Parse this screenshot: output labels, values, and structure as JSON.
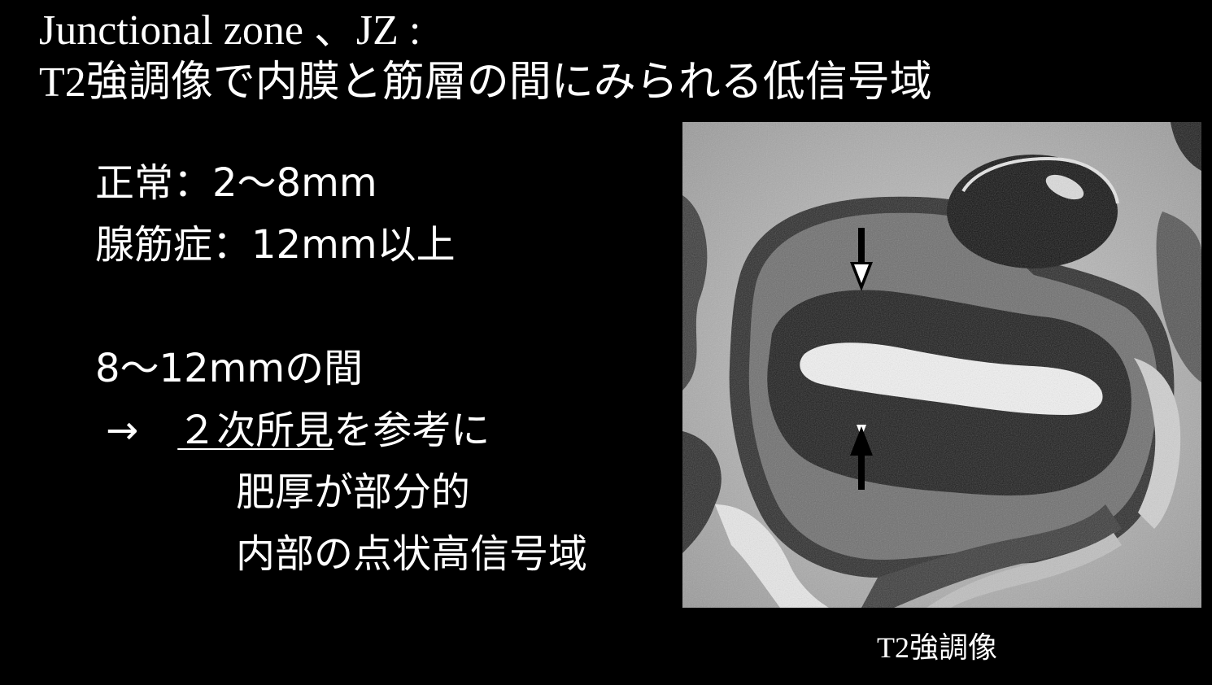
{
  "title": {
    "line1": "Junctional zone 、JZ :",
    "line2": "T2強調像で内膜と筋層の間にみられる低信号域"
  },
  "body": {
    "normal": "正常：2～8mm",
    "adenomyosis": "腺筋症：12mm以上",
    "between": "8～12mmの間",
    "arrow": "→",
    "secondary_underlined": "２次所見",
    "secondary_rest": "を参考に",
    "finding1": "肥厚が部分的",
    "finding2": "内部の点状高信号域"
  },
  "image": {
    "caption": "T2強調像",
    "arrow_icons": [
      "down-arrow-icon",
      "up-arrow-icon"
    ]
  }
}
